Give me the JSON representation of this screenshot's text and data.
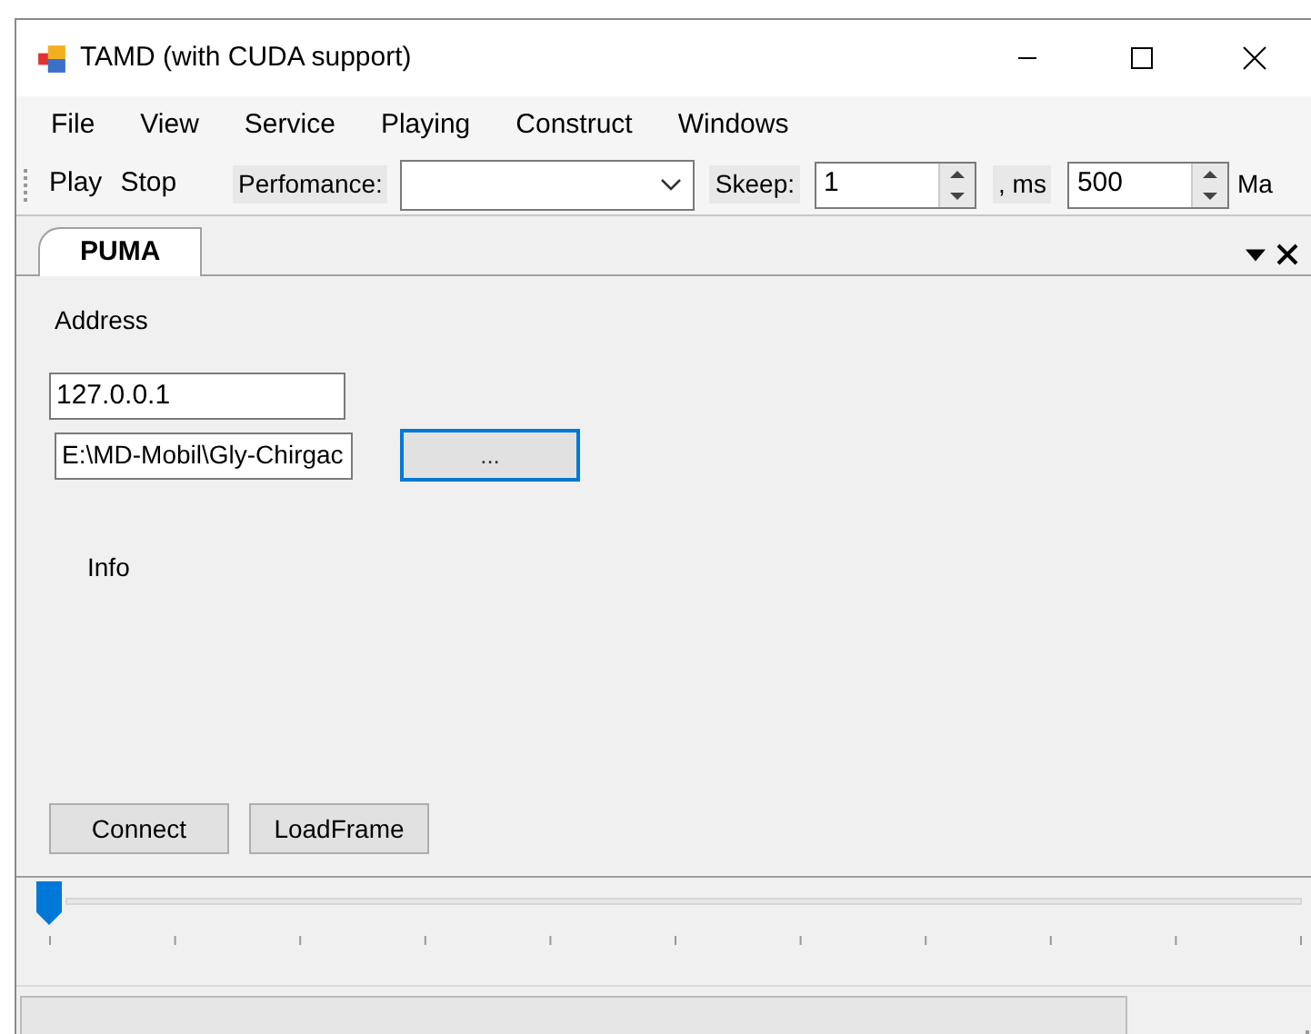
{
  "window": {
    "title": "TAMD (with CUDA support)"
  },
  "menu": [
    "File",
    "View",
    "Service",
    "Playing",
    "Construct",
    "Windows"
  ],
  "toolbar": {
    "buttons": [
      "Play",
      "Stop"
    ],
    "performance_label": "Perfomance:",
    "skeep_label": "Skeep:",
    "skeep_value": "1",
    "ms_label": ", ms",
    "ms_value": "500",
    "cut_label": "Ma"
  },
  "tabs": [
    {
      "label": "PUMA",
      "selected": true
    }
  ],
  "panel": {
    "address_label": "Address",
    "address_value": "127.0.0.1",
    "path_value": "E:\\MD-Mobil\\Gly-Chirgac",
    "browse_button": "...",
    "info_label": "Info",
    "buttons": [
      "Connect",
      "LoadFrame"
    ]
  },
  "slider": {
    "level": 0
  }
}
